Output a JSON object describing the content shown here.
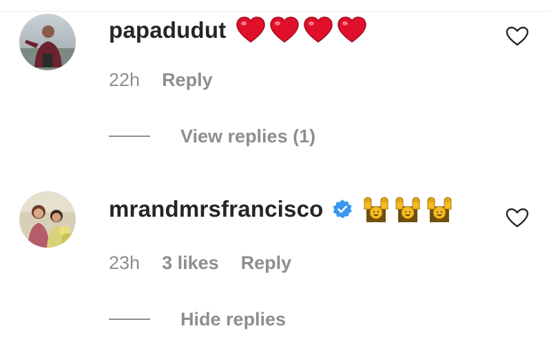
{
  "comments": [
    {
      "username": "papadudut",
      "verified": false,
      "emoji": [
        "red-heart",
        "red-heart",
        "red-heart",
        "red-heart"
      ],
      "time": "22h",
      "likes": "",
      "reply_label": "Reply",
      "replies_toggle_label": "View replies (1)"
    },
    {
      "username": "mrandmrsfrancisco",
      "verified": true,
      "emoji": [
        "person-raising-hands",
        "person-raising-hands",
        "person-raising-hands"
      ],
      "time": "23h",
      "likes": "3 likes",
      "reply_label": "Reply",
      "replies_toggle_label": "Hide replies"
    }
  ],
  "icons": {
    "like": "heart-outline-icon",
    "verified": "verified-badge-icon"
  },
  "colors": {
    "text_primary": "#262626",
    "text_secondary": "#8e8e8e",
    "verified_blue": "#3897f0",
    "heart_red": "#e0102a",
    "emoji_yellow": "#f5b921"
  }
}
